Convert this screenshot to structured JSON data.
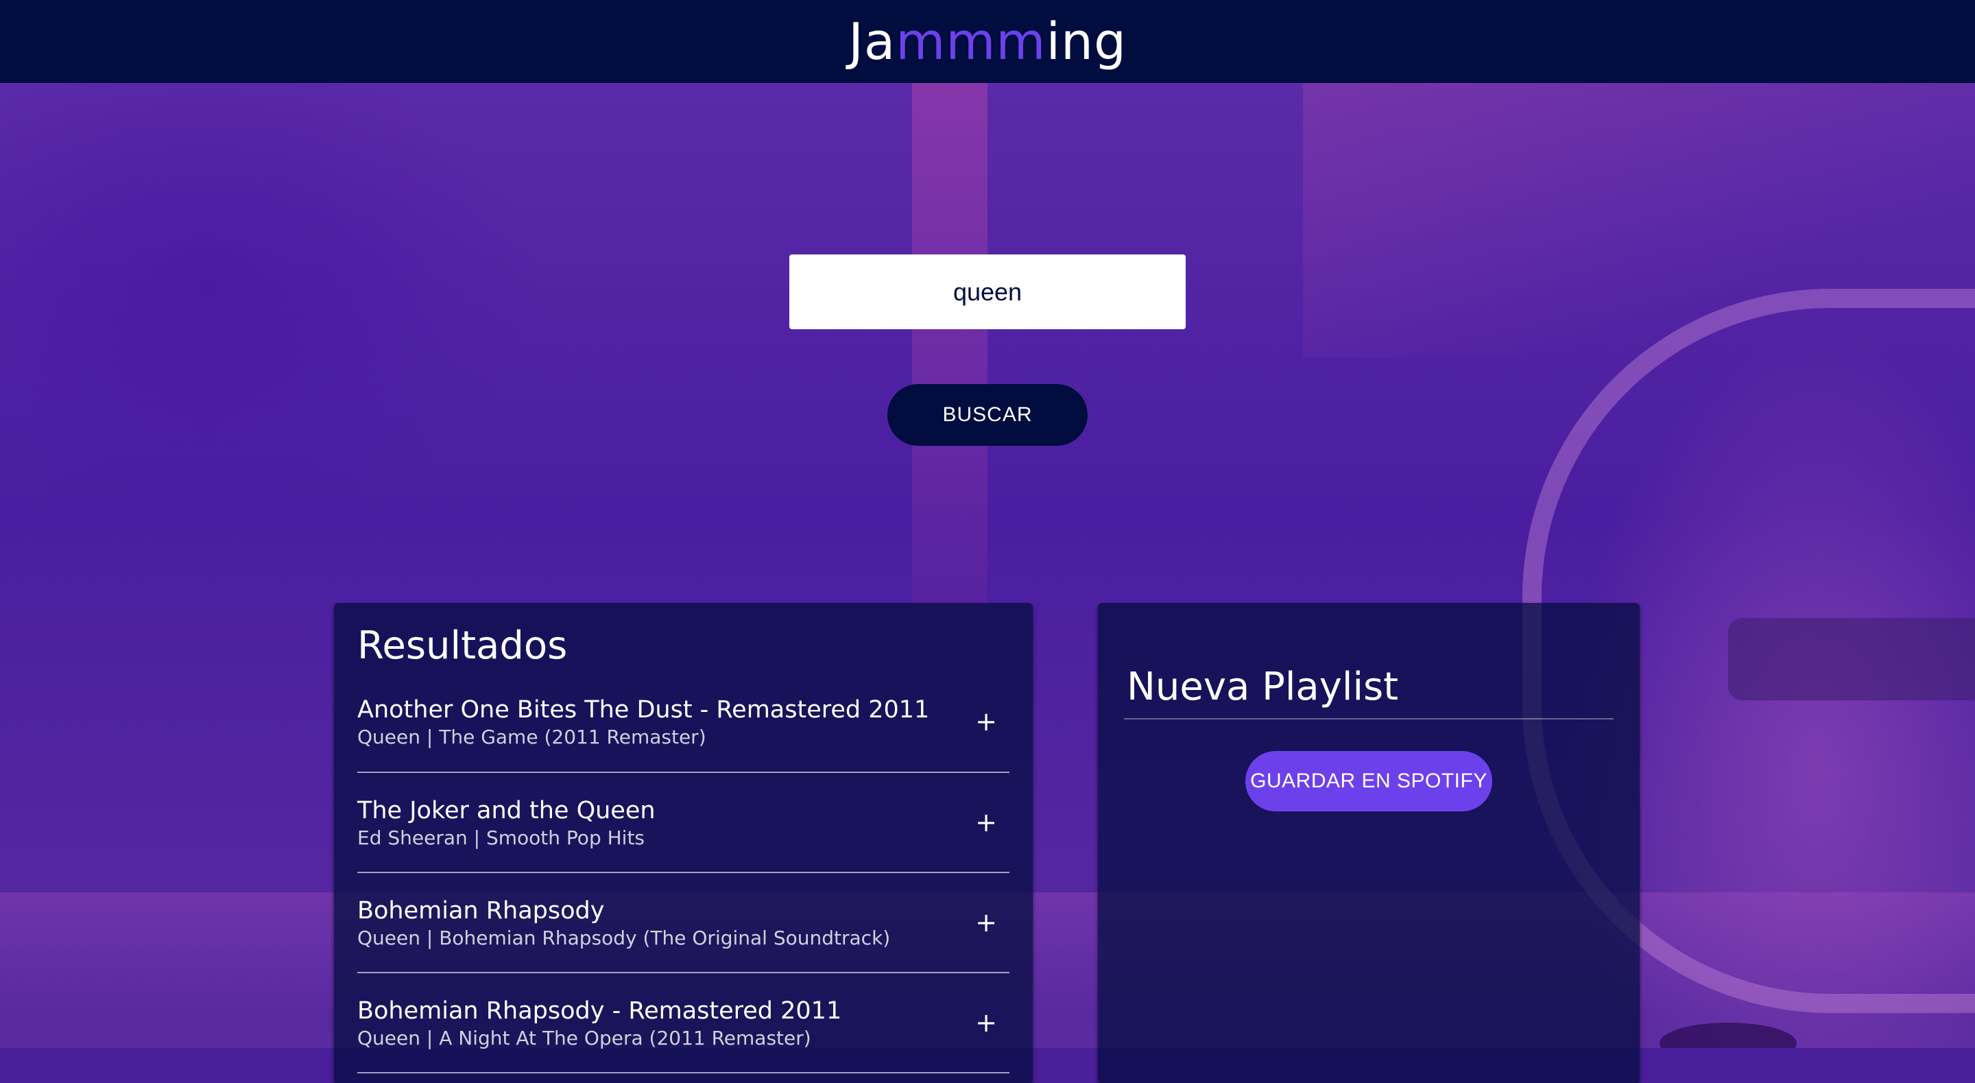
{
  "header": {
    "logo_pre": "Ja",
    "logo_accent": "mmm",
    "logo_post": "ing"
  },
  "search": {
    "value": "queen",
    "button_label": "BUSCAR"
  },
  "results": {
    "title": "Resultados",
    "tracks": [
      {
        "name": "Another One Bites The Dust - Remastered 2011",
        "meta": "Queen | The Game (2011 Remaster)",
        "action": "+"
      },
      {
        "name": "The Joker and the Queen",
        "meta": "Ed Sheeran | Smooth Pop Hits",
        "action": "+"
      },
      {
        "name": "Bohemian Rhapsody",
        "meta": "Queen | Bohemian Rhapsody (The Original Soundtrack)",
        "action": "+"
      },
      {
        "name": "Bohemian Rhapsody - Remastered 2011",
        "meta": "Queen | A Night At The Opera (2011 Remaster)",
        "action": "+"
      }
    ]
  },
  "playlist": {
    "name": "Nueva Playlist",
    "save_label": "GUARDAR EN SPOTIFY"
  },
  "colors": {
    "header_bg": "#010c3f",
    "accent": "#6c41ec",
    "panel_bg": "rgba(1,12,63,0.72)"
  }
}
